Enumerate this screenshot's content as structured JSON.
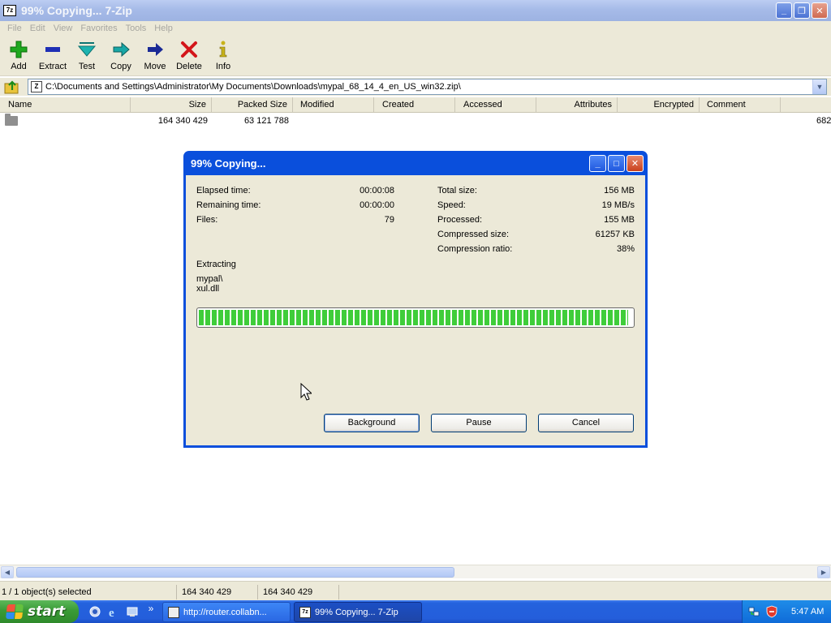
{
  "window": {
    "title": "99% Copying... 7-Zip",
    "app_icon": "7z",
    "controls": [
      "minimize-icon",
      "restore-icon",
      "close-icon"
    ]
  },
  "menu": [
    "File",
    "Edit",
    "View",
    "Favorites",
    "Tools",
    "Help"
  ],
  "toolbar": [
    {
      "label": "Add",
      "icon": "add-icon",
      "color": "#1fa81f"
    },
    {
      "label": "Extract",
      "icon": "extract-icon",
      "color": "#1e2fb5"
    },
    {
      "label": "Test",
      "icon": "test-icon",
      "color": "#1cb3b0"
    },
    {
      "label": "Copy",
      "icon": "copy-icon",
      "color": "#18a7a6"
    },
    {
      "label": "Move",
      "icon": "move-icon",
      "color": "#1a2a96"
    },
    {
      "label": "Delete",
      "icon": "delete-icon",
      "color": "#d3161a"
    },
    {
      "label": "Info",
      "icon": "info-icon",
      "color": "#c8b21a"
    }
  ],
  "address": {
    "path": "C:\\Documents and Settings\\Administrator\\My Documents\\Downloads\\mypal_68_14_4_en_US_win32.zip\\"
  },
  "columns": [
    "Name",
    "Size",
    "Packed Size",
    "Modified",
    "Created",
    "Accessed",
    "Attributes",
    "Encrypted",
    "Comment"
  ],
  "rows": [
    {
      "name": "",
      "size": "164 340 429",
      "packed": "63 121 788",
      "overflow": "682"
    }
  ],
  "status": {
    "selected": "1 / 1 object(s) selected",
    "size": "164 340 429",
    "packed": "164 340 429"
  },
  "dialog": {
    "title": "99% Copying...",
    "left_stats": [
      {
        "label": "Elapsed time:",
        "value": "00:00:08"
      },
      {
        "label": "Remaining time:",
        "value": "00:00:00"
      },
      {
        "label": "Files:",
        "value": "79"
      }
    ],
    "right_stats": [
      {
        "label": "Total size:",
        "value": "156 MB"
      },
      {
        "label": "Speed:",
        "value": "19 MB/s"
      },
      {
        "label": "Processed:",
        "value": "155 MB"
      },
      {
        "label": "Compressed size:",
        "value": "61257 KB"
      },
      {
        "label": "Compression ratio:",
        "value": "38%"
      }
    ],
    "action": "Extracting",
    "current_dir": "mypal\\",
    "current_file": "xul.dll",
    "progress": 0.99,
    "progress_color": "#3fcd3a",
    "buttons": {
      "background": "Background",
      "pause": "Pause",
      "cancel": "Cancel"
    }
  },
  "taskbar": {
    "start": "start",
    "tasks": [
      {
        "label": "http://router.collabn..."
      },
      {
        "label": "99% Copying... 7-Zip"
      }
    ],
    "clock": "5:47 AM"
  }
}
